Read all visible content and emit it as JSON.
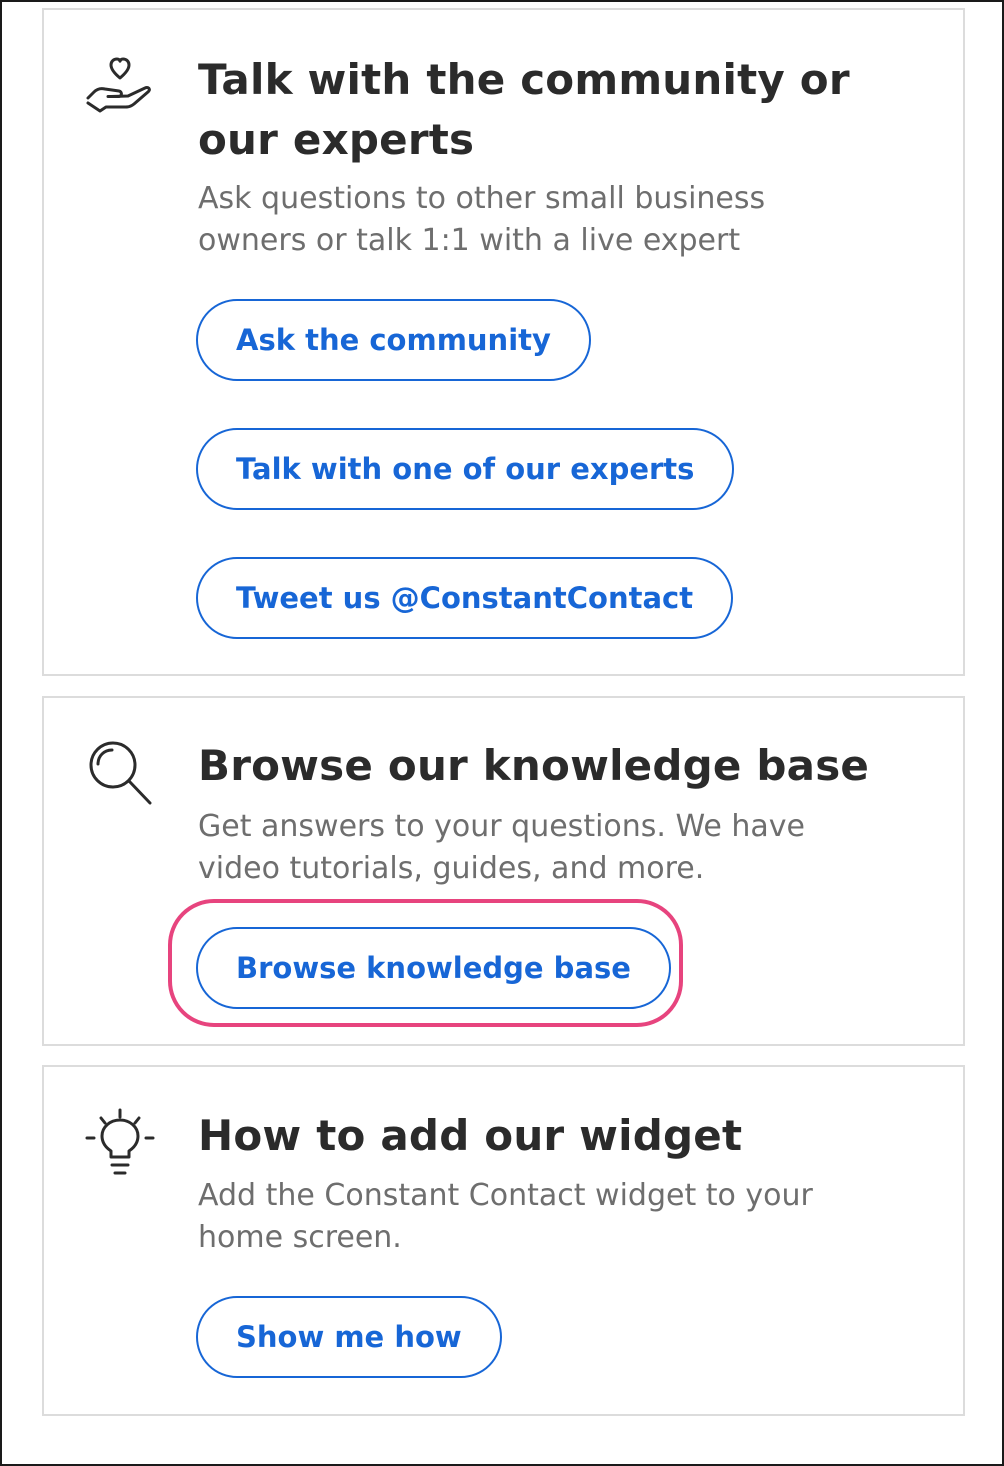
{
  "community": {
    "icon": "heart-hand-icon",
    "title": "Talk with the community or our experts",
    "description": "Ask questions to other small business owners or talk 1:1 with a live expert",
    "buttons": {
      "ask_community": "Ask the community",
      "talk_expert": "Talk with one of our experts",
      "tweet": "Tweet us @ConstantContact"
    }
  },
  "knowledge_base": {
    "icon": "search-icon",
    "title": "Browse our knowledge base",
    "description": "Get answers to your questions. We have video tutorials, guides, and more.",
    "button": "Browse knowledge base"
  },
  "widget": {
    "icon": "lightbulb-icon",
    "title": "How to add our widget",
    "description": "Add the Constant Contact widget to your home screen.",
    "button": "Show me how"
  },
  "colors": {
    "accent": "#1766d6",
    "highlight": "#e7447e",
    "title": "#2b2b2b",
    "description": "#6e6e6e",
    "card_border": "#dcdcdc"
  }
}
